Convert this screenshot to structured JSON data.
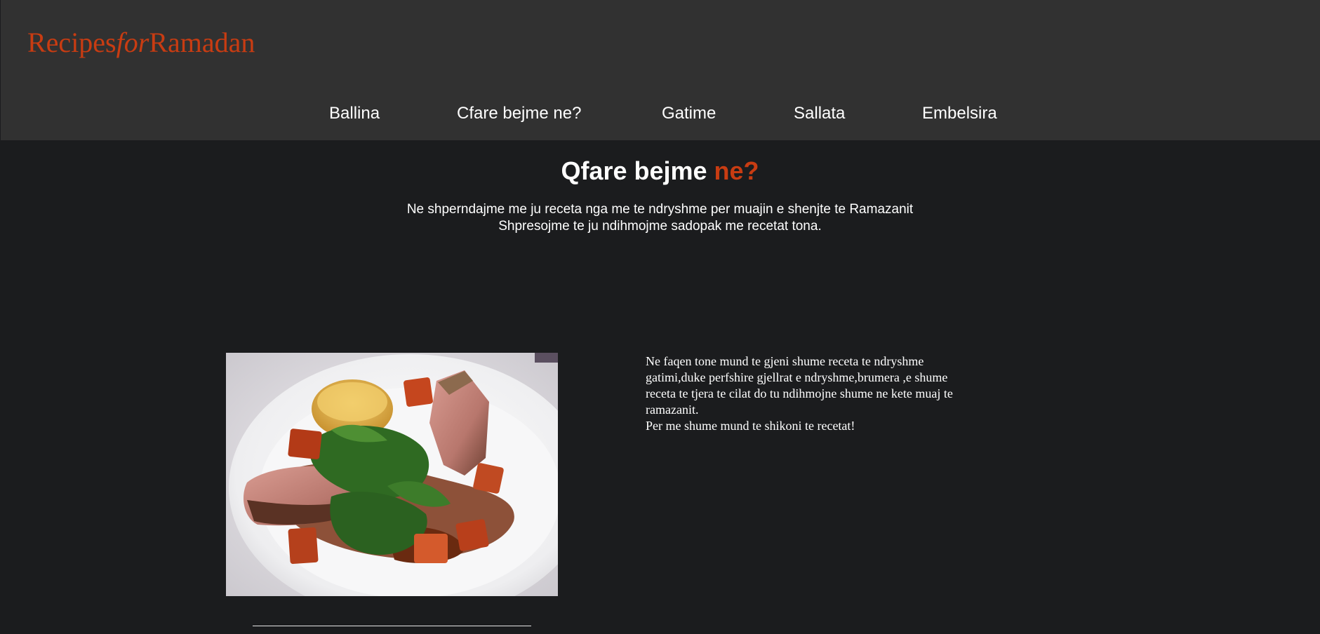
{
  "header": {
    "logo": {
      "part1": "Recipes",
      "part2": "for",
      "part3": "Ramadan"
    },
    "nav": [
      {
        "label": "Ballina"
      },
      {
        "label": "Cfare bejme ne?"
      },
      {
        "label": "Gatime"
      },
      {
        "label": "Sallata"
      },
      {
        "label": "Embelsira"
      }
    ]
  },
  "hero": {
    "title_main": "Qfare bejme",
    "title_accent": "ne?",
    "line1": "Ne shperndajme me ju receta nga me te ndryshme per muajin e shenjte te Ramazanit",
    "line2": "Shpresojme te ju ndihmojme sadopak me recetat tona."
  },
  "content": {
    "image_icon": "plated-meat-dish-photo",
    "paragraph": "Ne faqen tone mund te gjeni shume receta te ndryshme gatimi,duke perfshire gjellrat e ndryshme,brumera ,e shume receta te tjera te cilat do tu ndihmojne shume ne kete muaj te ramazanit.",
    "paragraph2": "Per me shume mund te shikoni te recetat!"
  },
  "colors": {
    "accent": "#c83c12",
    "header_bg": "#313131",
    "page_bg": "#1b1c1e",
    "text": "#ffffff"
  }
}
